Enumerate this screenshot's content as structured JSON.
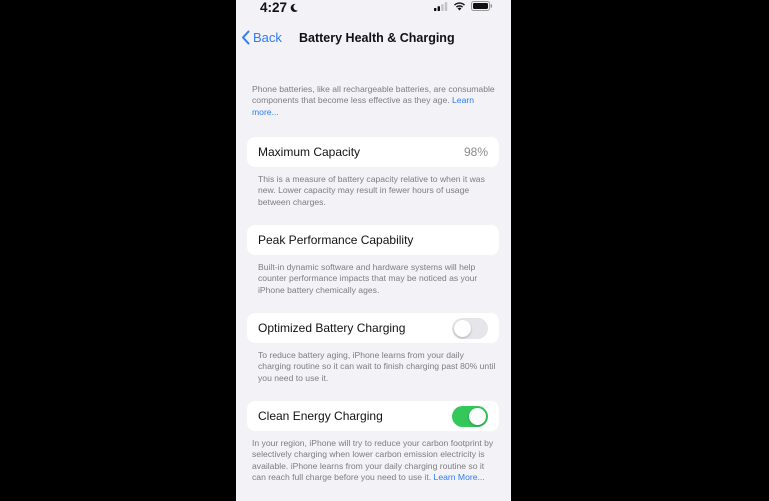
{
  "status_bar": {
    "time": "4:27"
  },
  "nav": {
    "back_label": "Back",
    "title": "Battery Health & Charging"
  },
  "intro": {
    "text": "Phone batteries, like all rechargeable batteries, are consumable components that become less effective as they age.",
    "link": "Learn more..."
  },
  "max_capacity": {
    "label": "Maximum Capacity",
    "value": "98%",
    "footnote": "This is a measure of battery capacity relative to when it was new. Lower capacity may result in fewer hours of usage between charges."
  },
  "peak_performance": {
    "label": "Peak Performance Capability",
    "footnote": "Built-in dynamic software and hardware systems will help counter performance impacts that may be noticed as your iPhone battery chemically ages."
  },
  "optimized_charging": {
    "label": "Optimized Battery Charging",
    "enabled": false,
    "footnote": "To reduce battery aging, iPhone learns from your daily charging routine so it can wait to finish charging past 80% until you need to use it."
  },
  "clean_energy": {
    "label": "Clean Energy Charging",
    "enabled": true,
    "footnote": "In your region, iPhone will try to reduce your carbon footprint by selectively charging when lower carbon emission electricity is available. iPhone learns from your daily charging routine so it can reach full charge before you need to use it.",
    "link": "Learn More..."
  },
  "colors": {
    "accent": "#2f7cf6",
    "toggle_on": "#34c759",
    "toggle_off": "#e5e5ea",
    "background": "#f2f2f7"
  },
  "icons": [
    "moon-icon",
    "cellular-signal-icon",
    "wifi-icon",
    "battery-icon",
    "chevron-left-icon"
  ]
}
